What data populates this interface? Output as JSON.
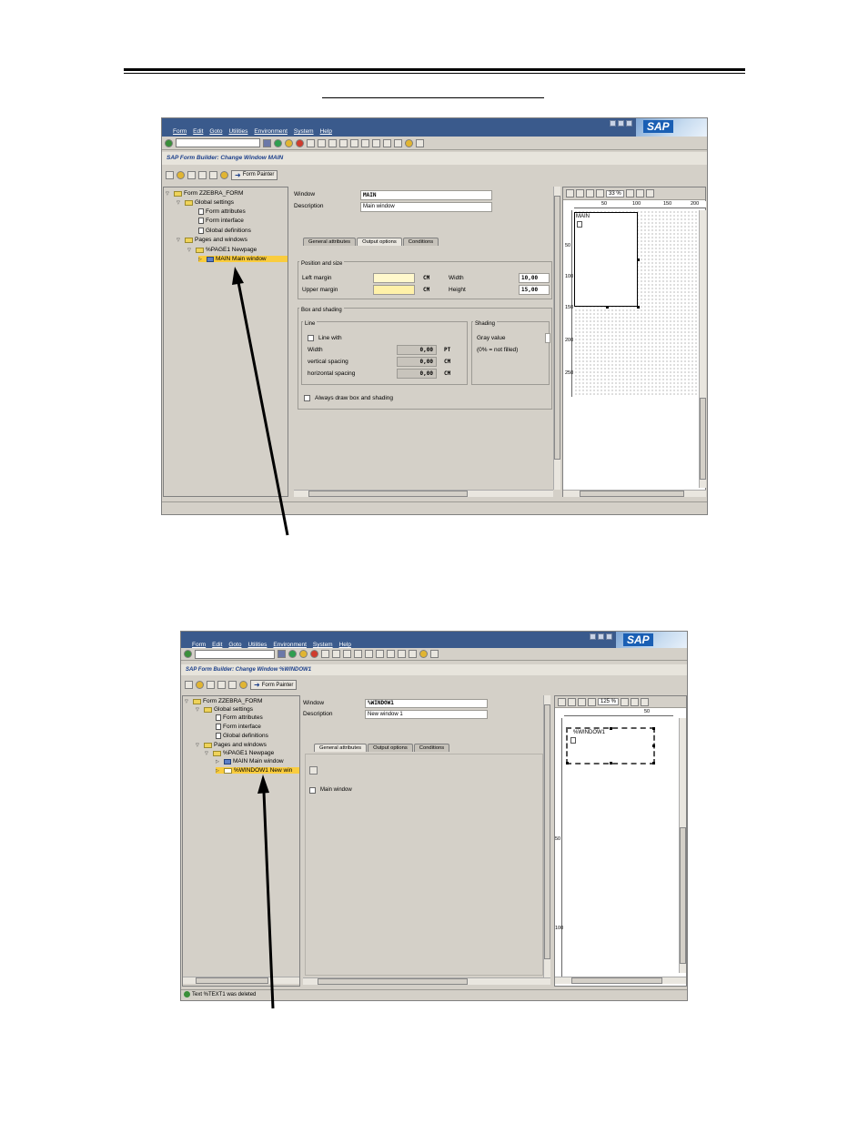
{
  "screens": [
    {
      "menu": [
        "Form",
        "Edit",
        "Goto",
        "Utilities",
        "Environment",
        "System",
        "Help"
      ],
      "app_title": "SAP Form Builder: Change Window MAIN",
      "form_painter_label": "Form Painter",
      "tree": {
        "form": "Form ZZEBRA_FORM",
        "global_settings": "Global settings",
        "form_attributes": "Form attributes",
        "form_interface": "Form interface",
        "global_definitions": "Global definitions",
        "pages_and_windows": "Pages and windows",
        "page": "%PAGE1 Newpage",
        "selected_window": "MAIN Main window"
      },
      "window_label": "Window",
      "window_value": "MAIN",
      "description_label": "Description",
      "description_value": "Main window",
      "tabs": [
        "General attributes",
        "Output options",
        "Conditions"
      ],
      "active_tab": "Output options",
      "position_group": "Position and size",
      "left_margin_label": "Left margin",
      "left_margin_value": "",
      "left_margin_unit": "CM",
      "upper_margin_label": "Upper margin",
      "upper_margin_value": "",
      "upper_margin_unit": "CM",
      "width_label": "Width",
      "width_value": "10,00",
      "height_label": "Height",
      "height_value": "15,00",
      "box_group": "Box and shading",
      "line_group": "Line",
      "line_with_label": "Line with",
      "line_width_label": "Width",
      "line_width_value": "0,00",
      "line_width_unit": "PT",
      "vertical_spacing_label": "vertical spacing",
      "vertical_spacing_value": "0,00",
      "vertical_spacing_unit": "CM",
      "horizontal_spacing_label": "horizontal spacing",
      "horizontal_spacing_value": "0,00",
      "horizontal_spacing_unit": "CM",
      "shading_group": "Shading",
      "gray_value_label": "Gray value",
      "gray_value_hint": "(0% = not filled)",
      "always_draw_label": "Always draw box and shading",
      "zoom": "33 %",
      "ruler_marks": [
        "50",
        "100",
        "150",
        "200"
      ],
      "vruler_marks": [
        "50",
        "100",
        "150",
        "200",
        "250"
      ],
      "painter_window_label": "MAIN"
    },
    {
      "menu": [
        "Form",
        "Edit",
        "Goto",
        "Utilities",
        "Environment",
        "System",
        "Help"
      ],
      "app_title": "SAP Form Builder: Change Window %WINDOW1",
      "form_painter_label": "Form Painter",
      "tree": {
        "form": "Form ZZEBRA_FORM",
        "global_settings": "Global settings",
        "form_attributes": "Form attributes",
        "form_interface": "Form interface",
        "global_definitions": "Global definitions",
        "pages_and_windows": "Pages and windows",
        "page": "%PAGE1 Newpage",
        "main_window": "MAIN Main window",
        "selected_window": "%WINDOW1 New win"
      },
      "window_label": "Window",
      "window_value": "%WINDOW1",
      "description_label": "Description",
      "description_value": "New window 1",
      "tabs": [
        "General attributes",
        "Output options",
        "Conditions"
      ],
      "active_tab": "General attributes",
      "main_window_label": "Main window",
      "zoom": "125 %",
      "ruler_marks": [
        "50"
      ],
      "vruler_marks": [
        "50",
        "100"
      ],
      "painter_window_label": "%WINDOW1",
      "status_message": "Text %TEXT1 was deleted"
    }
  ],
  "colors": {
    "menubar": "#3a5a8c",
    "selection": "#f9cc3e",
    "background": "#d4d0c8",
    "title_text": "#1a3e8a"
  }
}
